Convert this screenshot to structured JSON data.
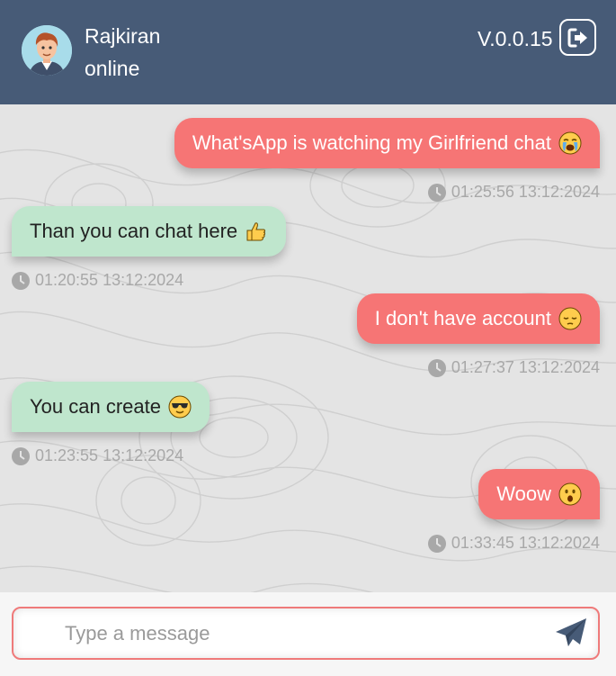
{
  "header": {
    "user_name": "Rajkiran",
    "status": "online",
    "version": "V.0.0.15",
    "avatar_icon": "user-avatar-cartoon-man",
    "logout_icon": "sign-out-icon",
    "background_color": "#475b77"
  },
  "messages": [
    {
      "direction": "out",
      "text": "What'sApp is watching my Girlfriend chat",
      "emoji": "crying-face",
      "time": "01:25:56 13:12:2024"
    },
    {
      "direction": "in",
      "text": "Than you can chat here",
      "emoji": "thumbs-up",
      "time": "01:20:55 13:12:2024"
    },
    {
      "direction": "out",
      "text": "I don't have account",
      "emoji": "pensive-face",
      "time": "01:27:37 13:12:2024"
    },
    {
      "direction": "in",
      "text": "You can create",
      "emoji": "sunglasses-face",
      "time": "01:23:55 13:12:2024"
    },
    {
      "direction": "out",
      "text": "Woow",
      "emoji": "astonished-face",
      "time": "01:33:45 13:12:2024"
    }
  ],
  "composer": {
    "placeholder": "Type a message",
    "value": "",
    "send_icon": "paper-plane-icon"
  },
  "colors": {
    "outgoing_bubble": "#f67575",
    "incoming_bubble": "#bfe6cd",
    "chat_background": "#e4e4e4",
    "input_border": "#ef7a7a"
  }
}
